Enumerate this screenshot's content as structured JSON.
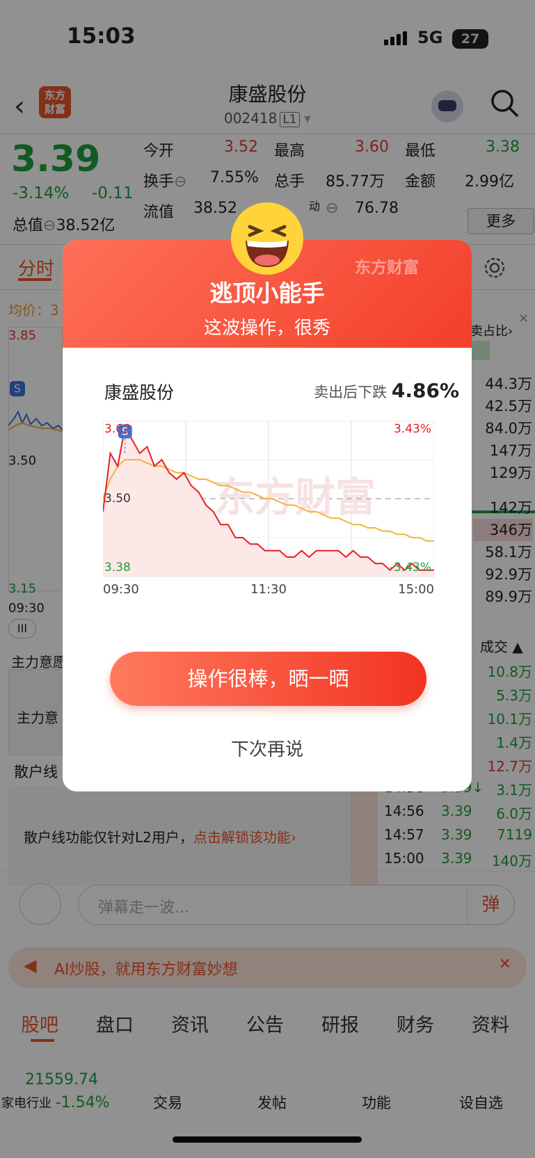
{
  "status_bar": {
    "time": "15:03",
    "network": "5G",
    "battery": "27"
  },
  "header": {
    "back": "‹",
    "logo_line1": "东方",
    "logo_line2": "财富",
    "title": "康盛股份",
    "code": "002418",
    "level": "L1"
  },
  "quote": {
    "price": "3.39",
    "change_pct": "-3.14%",
    "change": "-0.11",
    "labels": {
      "open": "今开",
      "high": "最高",
      "low": "最低",
      "turnover": "换手",
      "volume": "总手",
      "amount": "金额",
      "mcap": "总值",
      "float_cap": "流值",
      "pe": "动"
    },
    "open": "3.52",
    "high": "3.60",
    "low": "3.38",
    "turnover": "7.55%",
    "volume": "85.77万",
    "amount": "2.99亿",
    "mcap": "38.52亿",
    "float_cap": "38.52",
    "pe": "76.78",
    "more": "更多"
  },
  "bg": {
    "tab_active": "分时",
    "avg": "均价：3",
    "y_high": "3.85",
    "y_mid": "3.50",
    "y_low": "3.15",
    "t_start": "09:30",
    "zhuli1": "主力意愿",
    "zhuli2": "主力意",
    "sanhu": "散户线",
    "sanhu_msg": "散户线功能仅针对L2用户，",
    "sanhu_link": "点击解锁该功能›",
    "ratio": "卖占比›",
    "order_vols": [
      "44.3万",
      "42.5万",
      "84.0万",
      "147万",
      "129万",
      "142万",
      "346万",
      "58.1万",
      "92.9万",
      "89.9万"
    ],
    "trades_title": "成交",
    "trades": [
      {
        "t": "",
        "p": "",
        "v": "10.8万"
      },
      {
        "t": "",
        "p": "↑",
        "v": "5.3万"
      },
      {
        "t": "",
        "p": "↓",
        "v": "10.1万"
      },
      {
        "t": "",
        "p": "↑",
        "v": "1.4万"
      },
      {
        "t": "",
        "p": "",
        "v": "12.7万"
      },
      {
        "t": "14:56",
        "p": "3.39↓",
        "v": "3.1万"
      },
      {
        "t": "14:56",
        "p": "3.39",
        "v": "6.0万"
      },
      {
        "t": "14:57",
        "p": "3.39",
        "v": "7119"
      },
      {
        "t": "15:00",
        "p": "3.39",
        "v": "140万"
      }
    ],
    "danmu_placeholder": "弹幕走一波...",
    "danmu_btn": "弹",
    "ad": "AI炒股，就用东方财富妙想",
    "ad_close": "✕"
  },
  "modal": {
    "brand": "东方财富",
    "title": "逃顶小能手",
    "subtitle": "这波操作，很秀",
    "stock": "康盛股份",
    "drop_label": "卖出后下跌 ",
    "drop_value": "4.86%",
    "button": "操作很棒，晒一晒",
    "later": "下次再说"
  },
  "chart_data": {
    "type": "line",
    "x_ticks": [
      "09:30",
      "11:30",
      "15:00"
    ],
    "y_labels": {
      "top": "3.62",
      "mid": "3.50",
      "bottom": "3.38"
    },
    "pct_labels": {
      "top": "3.43%",
      "bottom": "-3.43%"
    },
    "ylim": [
      3.38,
      3.62
    ],
    "sell_marker": "S",
    "series": [
      {
        "values": [
          3.48,
          3.57,
          3.55,
          3.61,
          3.59,
          3.57,
          3.58,
          3.55,
          3.56,
          3.54,
          3.53,
          3.54,
          3.52,
          3.51,
          3.49,
          3.48,
          3.46,
          3.46,
          3.44,
          3.44,
          3.43,
          3.43,
          3.42,
          3.42,
          3.42,
          3.41,
          3.41,
          3.42,
          3.41,
          3.42,
          3.42,
          3.42,
          3.42,
          3.41,
          3.42,
          3.41,
          3.41,
          3.4,
          3.4,
          3.39,
          3.4,
          3.39,
          3.4,
          3.39,
          3.39,
          3.39
        ]
      },
      {
        "values": [
          3.5,
          3.53,
          3.55,
          3.56,
          3.56,
          3.56,
          3.555,
          3.55,
          3.55,
          3.545,
          3.54,
          3.54,
          3.535,
          3.53,
          3.53,
          3.525,
          3.52,
          3.52,
          3.515,
          3.51,
          3.51,
          3.505,
          3.5,
          3.5,
          3.495,
          3.49,
          3.49,
          3.485,
          3.48,
          3.48,
          3.475,
          3.47,
          3.47,
          3.465,
          3.46,
          3.46,
          3.455,
          3.455,
          3.45,
          3.45,
          3.445,
          3.445,
          3.44,
          3.44,
          3.435,
          3.435
        ]
      }
    ],
    "colors": {
      "price": "#e32121",
      "avg": "#f4b433",
      "fill": "#fde8e8"
    }
  }
}
